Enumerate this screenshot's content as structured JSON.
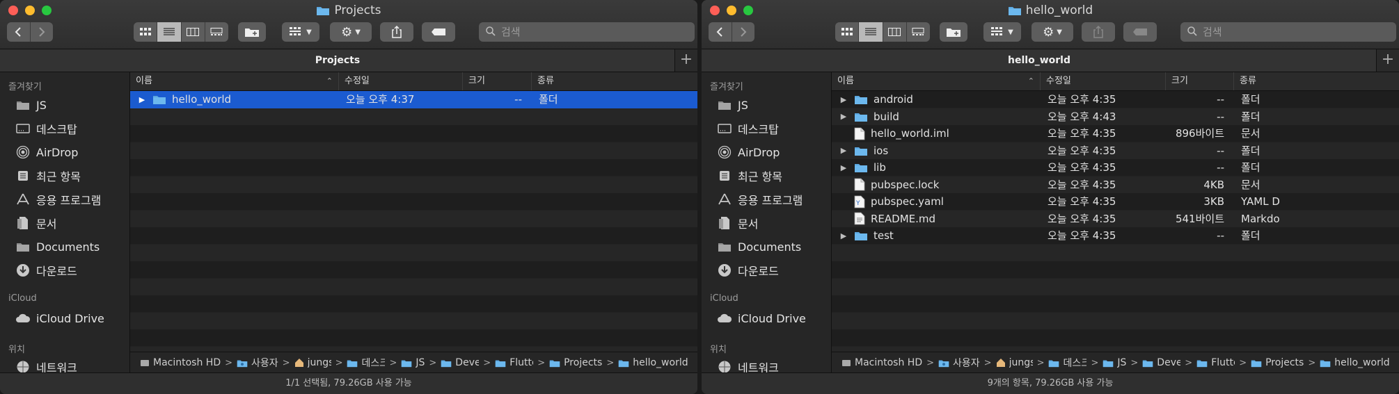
{
  "left": {
    "title": "Projects",
    "tab": "Projects",
    "search_placeholder": "검색",
    "sidebar": {
      "favorites_header": "즐겨찾기",
      "items": [
        {
          "label": "JS",
          "icon": "folder-icon"
        },
        {
          "label": "데스크탑",
          "icon": "desktop-icon"
        },
        {
          "label": "AirDrop",
          "icon": "airdrop-icon"
        },
        {
          "label": "최근 항목",
          "icon": "recents-icon"
        },
        {
          "label": "응용 프로그램",
          "icon": "applications-icon"
        },
        {
          "label": "문서",
          "icon": "document-icon"
        },
        {
          "label": "Documents",
          "icon": "folder-icon"
        },
        {
          "label": "다운로드",
          "icon": "download-icon"
        }
      ],
      "icloud_header": "iCloud",
      "icloud_item": "iCloud Drive",
      "locations_header": "위치",
      "locations_item": "네트워크"
    },
    "columns": {
      "name": "이름",
      "date": "수정일",
      "size": "크기",
      "kind": "종류"
    },
    "rows": [
      {
        "name": "hello_world",
        "date": "오늘 오후 4:37",
        "size": "--",
        "kind": "폴더",
        "type": "folder",
        "expandable": true,
        "selected": true
      }
    ],
    "path": [
      "Macintosh HD",
      "사용자",
      "jungs",
      "데스크탑",
      "JS",
      "Deve",
      "Flutte",
      "Projects",
      "hello_world"
    ],
    "status": "1/1 선택됨, 79.26GB 사용 가능"
  },
  "right": {
    "title": "hello_world",
    "tab": "hello_world",
    "search_placeholder": "검색",
    "sidebar": {
      "favorites_header": "즐겨찾기",
      "items": [
        {
          "label": "JS",
          "icon": "folder-icon"
        },
        {
          "label": "데스크탑",
          "icon": "desktop-icon"
        },
        {
          "label": "AirDrop",
          "icon": "airdrop-icon"
        },
        {
          "label": "최근 항목",
          "icon": "recents-icon"
        },
        {
          "label": "응용 프로그램",
          "icon": "applications-icon"
        },
        {
          "label": "문서",
          "icon": "document-icon"
        },
        {
          "label": "Documents",
          "icon": "folder-icon"
        },
        {
          "label": "다운로드",
          "icon": "download-icon"
        }
      ],
      "icloud_header": "iCloud",
      "icloud_item": "iCloud Drive",
      "locations_header": "위치",
      "locations_item": "네트워크"
    },
    "columns": {
      "name": "이름",
      "date": "수정일",
      "size": "크기",
      "kind": "종류"
    },
    "rows": [
      {
        "name": "android",
        "date": "오늘 오후 4:35",
        "size": "--",
        "kind": "폴더",
        "type": "folder",
        "expandable": true
      },
      {
        "name": "build",
        "date": "오늘 오후 4:43",
        "size": "--",
        "kind": "폴더",
        "type": "folder",
        "expandable": true
      },
      {
        "name": "hello_world.iml",
        "date": "오늘 오후 4:35",
        "size": "896바이트",
        "kind": "문서",
        "type": "file",
        "expandable": false
      },
      {
        "name": "ios",
        "date": "오늘 오후 4:35",
        "size": "--",
        "kind": "폴더",
        "type": "folder",
        "expandable": true
      },
      {
        "name": "lib",
        "date": "오늘 오후 4:35",
        "size": "--",
        "kind": "폴더",
        "type": "folder",
        "expandable": true
      },
      {
        "name": "pubspec.lock",
        "date": "오늘 오후 4:35",
        "size": "4KB",
        "kind": "문서",
        "type": "file",
        "expandable": false
      },
      {
        "name": "pubspec.yaml",
        "date": "오늘 오후 4:35",
        "size": "3KB",
        "kind": "YAML D",
        "type": "yaml",
        "expandable": false
      },
      {
        "name": "README.md",
        "date": "오늘 오후 4:35",
        "size": "541바이트",
        "kind": "Markdo",
        "type": "md",
        "expandable": false
      },
      {
        "name": "test",
        "date": "오늘 오후 4:35",
        "size": "--",
        "kind": "폴더",
        "type": "folder",
        "expandable": true
      }
    ],
    "path": [
      "Macintosh HD",
      "사용자",
      "jungs",
      "데스크탑",
      "JS",
      "Deve",
      "Flutte",
      "Projects",
      "hello_world"
    ],
    "status": "9개의 항목, 79.26GB 사용 가능"
  }
}
